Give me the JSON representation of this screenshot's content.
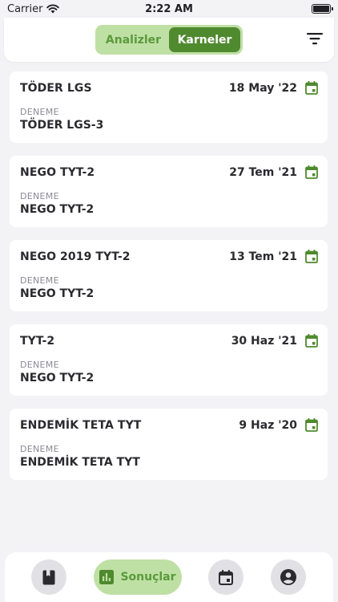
{
  "status_bar": {
    "carrier": "Carrier",
    "time": "2:22 AM"
  },
  "header": {
    "tabs": [
      {
        "label": "Analizler",
        "active": false
      },
      {
        "label": "Karneler",
        "active": true
      }
    ]
  },
  "cards": [
    {
      "title": "TÖDER LGS",
      "date": "18 May '22",
      "sub_label": "DENEME",
      "value": "TÖDER LGS-3"
    },
    {
      "title": "NEGO TYT-2",
      "date": "27 Tem '21",
      "sub_label": "DENEME",
      "value": "NEGO TYT-2"
    },
    {
      "title": "NEGO 2019 TYT-2",
      "date": "13 Tem '21",
      "sub_label": "DENEME",
      "value": "NEGO TYT-2"
    },
    {
      "title": "TYT-2",
      "date": "30 Haz '21",
      "sub_label": "DENEME",
      "value": "NEGO TYT-2"
    },
    {
      "title": "ENDEMİK TETA TYT",
      "date": "9 Haz '20",
      "sub_label": "DENEME",
      "value": "ENDEMİK TETA TYT"
    }
  ],
  "bottom_nav": {
    "items": [
      {
        "icon": "book-icon"
      },
      {
        "icon": "bar-chart-icon",
        "label": "Sonuçlar",
        "active": true
      },
      {
        "icon": "calendar-icon"
      },
      {
        "icon": "account-icon"
      }
    ]
  },
  "colors": {
    "accent_dark": "#4f8a2e",
    "accent_light": "#bfe0a5",
    "accent_text": "#5b9a3c",
    "background": "#f3f3f6",
    "card": "#ffffff"
  }
}
